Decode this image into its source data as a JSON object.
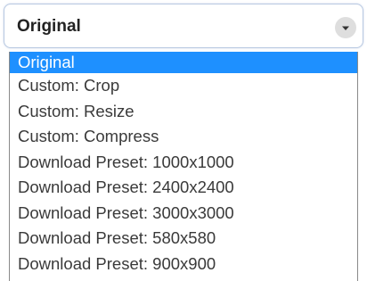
{
  "select": {
    "value": "Original",
    "caret_icon": "chevron-down-icon"
  },
  "dropdown": {
    "selected_index": 0,
    "selected_color": "#1e90ff",
    "options": [
      "Original",
      "Custom: Crop",
      "Custom: Resize",
      "Custom: Compress",
      "Download Preset: 1000x1000",
      "Download Preset: 2400x2400",
      "Download Preset: 3000x3000",
      "Download Preset: 580x580",
      "Download Preset: 900x900"
    ]
  }
}
